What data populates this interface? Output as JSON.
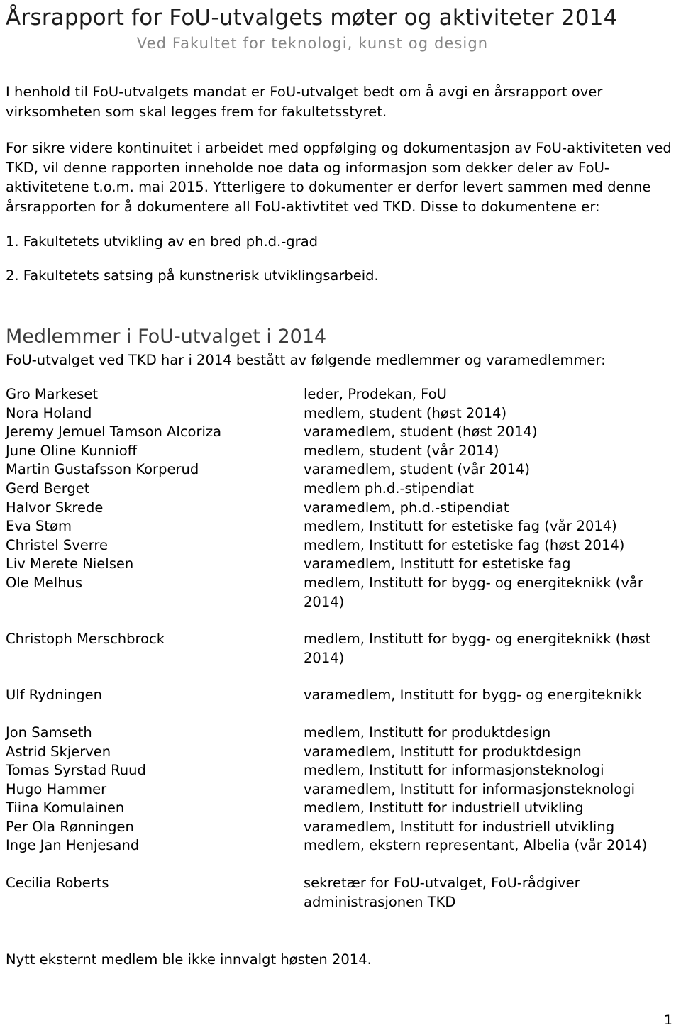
{
  "document": {
    "title": "Årsrapport for FoU-utvalgets møter og aktiviteter 2014",
    "subtitle": "Ved Fakultet for teknologi, kunst og design",
    "page_number": "1"
  },
  "intro": {
    "paragraph_1": "I henhold til FoU-utvalgets mandat er FoU-utvalget bedt om å avgi en årsrapport over virksomheten som skal legges frem for fakultetsstyret.",
    "paragraph_2": "For sikre videre kontinuitet i arbeidet med oppfølging og dokumentasjon av FoU-aktiviteten ved TKD, vil denne rapporten inneholde noe data og informasjon som dekker deler av FoU-aktivitetene t.o.m. mai 2015. Ytterligere to dokumenter er derfor levert sammen med denne årsrapporten for å dokumentere all FoU-aktivtitet ved TKD. Disse to dokumentene er:",
    "list": [
      "1. Fakultetets utvikling av en bred ph.d.-grad",
      "2. Fakultetets satsing på kunstnerisk utviklingsarbeid."
    ]
  },
  "members_section": {
    "heading": "Medlemmer i FoU-utvalget i 2014",
    "intro": "FoU-utvalget ved TKD har i 2014 bestått av følgende medlemmer og varamedlemmer:",
    "rows": [
      {
        "name": "Gro Markeset",
        "role": "leder, Prodekan, FoU",
        "spacer_after": false
      },
      {
        "name": "Nora Holand",
        "role": "medlem, student (høst 2014)",
        "spacer_after": false
      },
      {
        "name": "Jeremy Jemuel Tamson Alcoriza",
        "role": "varamedlem, student (høst 2014)",
        "spacer_after": false
      },
      {
        "name": "June Oline Kunnioff",
        "role": "medlem, student (vår 2014)",
        "spacer_after": false
      },
      {
        "name": "Martin Gustafsson Korperud",
        "role": "varamedlem, student (vår 2014)",
        "spacer_after": false
      },
      {
        "name": "Gerd Berget",
        "role": "medlem ph.d.-stipendiat",
        "spacer_after": false
      },
      {
        "name": "Halvor Skrede",
        "role": "varamedlem, ph.d.-stipendiat",
        "spacer_after": false
      },
      {
        "name": "Eva Støm",
        "role": "medlem, Institutt for estetiske fag (vår 2014)",
        "spacer_after": false
      },
      {
        "name": "Christel Sverre",
        "role": "medlem, Institutt for estetiske fag (høst 2014)",
        "spacer_after": false
      },
      {
        "name": "Liv Merete Nielsen",
        "role": "varamedlem, Institutt for estetiske fag",
        "spacer_after": false
      },
      {
        "name": "Ole Melhus",
        "role": "medlem, Institutt for bygg- og energiteknikk (vår 2014)",
        "spacer_after": true
      },
      {
        "name": "Christoph Merschbrock",
        "role": "medlem, Institutt for bygg- og energiteknikk (høst 2014)",
        "spacer_after": true
      },
      {
        "name": "Ulf Rydningen",
        "role": "varamedlem, Institutt for bygg- og energiteknikk",
        "spacer_after": true
      },
      {
        "name": "Jon Samseth",
        "role": "medlem, Institutt for produktdesign",
        "spacer_after": false
      },
      {
        "name": "Astrid Skjerven",
        "role": "varamedlem, Institutt for produktdesign",
        "spacer_after": false
      },
      {
        "name": "Tomas Syrstad Ruud",
        "role": "medlem, Institutt for informasjonsteknologi",
        "spacer_after": false
      },
      {
        "name": "Hugo Hammer",
        "role": "varamedlem, Institutt for informasjonsteknologi",
        "spacer_after": false
      },
      {
        "name": "Tiina Komulainen",
        "role": "medlem, Institutt for industriell utvikling",
        "spacer_after": false
      },
      {
        "name": "Per Ola Rønningen",
        "role": "varamedlem, Institutt for industriell utvikling",
        "spacer_after": false
      },
      {
        "name": "Inge Jan Henjesand",
        "role": "medlem, ekstern representant, Albelia (vår 2014)",
        "spacer_after": true
      },
      {
        "name": "Cecilia Roberts",
        "role": "sekretær for FoU-utvalget, FoU-rådgiver administrasjonen TKD",
        "spacer_after": false
      }
    ]
  },
  "closing_note": "Nytt eksternt medlem ble ikke innvalgt høsten 2014."
}
